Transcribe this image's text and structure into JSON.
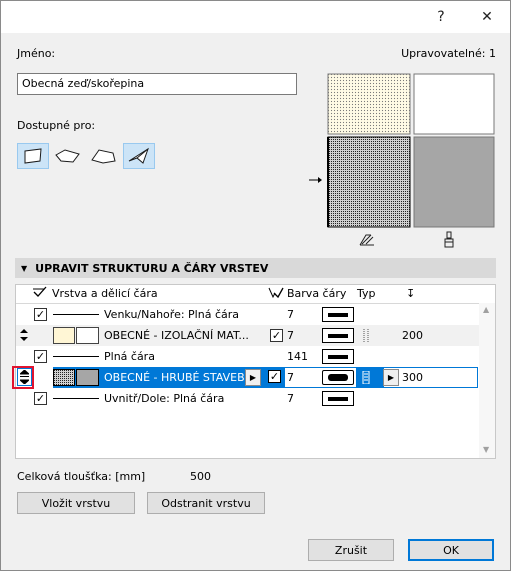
{
  "window": {
    "help_glyph": "?",
    "close_glyph": "✕"
  },
  "name": {
    "label": "Jméno:",
    "value": "Obecná zeď/skořepina",
    "editable_label": "Upravovatelné: 1"
  },
  "available": {
    "label": "Dostupné pro:"
  },
  "preview": {
    "icon_left": "skew-icon",
    "icon_right": "brush-icon"
  },
  "section": {
    "title": "UPRAVIT STRUKTURU A ČÁRY VRSTEV"
  },
  "grid": {
    "headers": {
      "layer": "Vrstva a dělicí čára",
      "pen": "Barva čáry",
      "type": "Typ",
      "thickness_icon": "↧"
    },
    "rows": [
      {
        "kind": "line",
        "label": "Venku/Nahoře: Plná čára",
        "pen": "7"
      },
      {
        "kind": "layer",
        "label": "OBECNÉ - IZOLAČNÍ MAT...",
        "pen": "7",
        "thickness": "200"
      },
      {
        "kind": "line",
        "label": "Plná čára",
        "pen": "141"
      },
      {
        "kind": "layer",
        "label": "OBECNÉ - HRUBÉ STAVEB...",
        "pen": "7",
        "thickness": "300",
        "selected": true
      },
      {
        "kind": "line",
        "label": "Uvnitř/Dole: Plná čára",
        "pen": "7"
      }
    ]
  },
  "total": {
    "label": "Celková tloušťka: [mm]",
    "value": "500"
  },
  "buttons": {
    "insert": "Vložit vrstvu",
    "remove": "Odstranit vrstvu",
    "cancel": "Zrušit",
    "ok": "OK"
  }
}
